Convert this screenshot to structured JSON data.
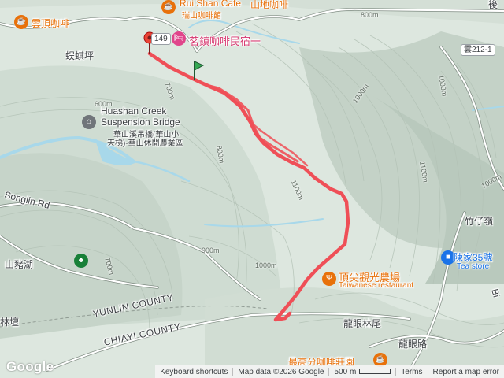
{
  "map": {
    "colors": {
      "track": "#ef4f57",
      "water": "#9fd7ec",
      "road": "#ffffff",
      "poi_orange": "#e8710a",
      "poi_pink": "#e0458b",
      "start_pin": "#34a853",
      "end_pin": "#ea4335"
    },
    "labels": {
      "yunding_cafe": "雲頂咖啡",
      "ruishan_cafe": "Rui Shan Cafe",
      "ruishan_cafe_zh": "瑞山咖啡館",
      "shandi_cafe": "山地咖啡",
      "wuqiping": "蜈蜞坪",
      "mingzhen_bnb": "茗鎮咖啡民宿一",
      "route_shield_left": "149",
      "huashan_bridge_en1": "Huashan Creek",
      "huashan_bridge_en2": "Suspension Bridge",
      "huashan_bridge_zh1": "華山溪吊橋(華山小",
      "huashan_bridge_zh2": "天梯)-華山休閒農業區",
      "songlin_rd": "Songlin Rd",
      "shanzhuhu": "山豬湖",
      "linlei": "林壇",
      "yunlin_county": "YUNLIN COUNTY",
      "chiayi_county": "CHIAYI COUNTY",
      "dingjian_farm": "頂尖觀光農場",
      "taiwanese_restaurant": "Taiwanese restaurant",
      "longyan_linwei": "龍眼林尾",
      "longyan_rd": "龍眼路",
      "zuigaofen_cafe": "最高分咖啡莊園",
      "zhuzailing": "竹仔嶺",
      "chenjia35": "陳家35號",
      "tea_store": "Tea store",
      "route_212": "雲212-1",
      "hou": "後",
      "bi": "Bi"
    },
    "contours": {
      "c800_top": "800m",
      "c600": "600m",
      "c700_a": "700m",
      "c800_b": "800m",
      "c1000_a": "1000m",
      "c1100_a": "1100m",
      "c900": "900m",
      "c1000_b": "1000m",
      "c700_b": "700m",
      "c1100_b": "1100m",
      "c1000_c": "1000m",
      "c1000_d": "1000m"
    },
    "logo": "Google",
    "footer": {
      "keyboard": "Keyboard shortcuts",
      "map_data": "Map data ©2026 Google",
      "scale": "500 m",
      "terms": "Terms",
      "report": "Report a map error"
    },
    "icons": {
      "cafe": "coffee-cup-icon",
      "lodging": "bed-icon",
      "bridge": "suspension-bridge-icon",
      "park": "tree-icon",
      "restaurant": "fork-knife-icon",
      "start": "green-flag-icon",
      "end": "red-map-pin-icon"
    }
  }
}
